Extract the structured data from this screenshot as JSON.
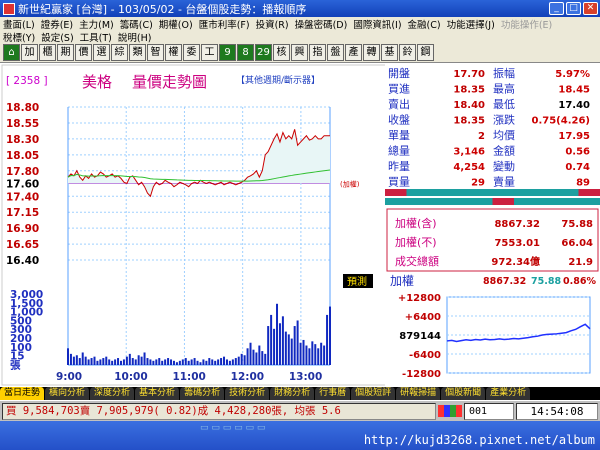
{
  "window": {
    "title": "新世紀贏家 [台灣] - 103/05/02 - 台盤個股走勢：播報順序"
  },
  "menu": {
    "row1": [
      "畫面(L)",
      "證券(E)",
      "主力(M)",
      "籌碼(C)",
      "期權(O)",
      "匯市利率(F)",
      "投資(R)",
      "操盤密碼(D)",
      "國際資訊(I)",
      "金融(C)",
      "功能選擇(J)"
    ],
    "row1_disabled": "功能操作(E)",
    "row2": [
      "稅標(Y)",
      "設定(S)",
      "工具(T)",
      "說明(H)"
    ]
  },
  "toolbar": {
    "buttons": [
      "加",
      "櫃",
      "期",
      "價",
      "選",
      "綜",
      "類",
      "智",
      "權",
      "委",
      "工",
      "9",
      "8",
      "29",
      "核",
      "興",
      "指",
      "盤",
      "產",
      "轉",
      "基",
      "鈴",
      "鋼"
    ]
  },
  "stock": {
    "code": "[ 2358 ]",
    "name": "美格",
    "chart_title": "量價走勢圖",
    "other_cycle": "【其他週期/斷示器】"
  },
  "price_axis": [
    "18.80",
    "18.55",
    "18.30",
    "18.05",
    "17.80",
    "17.60",
    "17.40",
    "17.15",
    "16.90",
    "16.65",
    "16.40"
  ],
  "ref_price_label": "(加權)",
  "volume_axis": [
    "3,000",
    "1,500",
    "1,000",
    "500",
    "300",
    "200",
    "100",
    "15",
    "張"
  ],
  "time_axis": [
    "9:00",
    "10:00",
    "11:00",
    "12:00",
    "13:00"
  ],
  "forecast_button": "預測",
  "quote": [
    {
      "l1": "開盤",
      "v1": "17.70",
      "l2": "振幅",
      "v2": "5.97%"
    },
    {
      "l1": "買進",
      "v1": "18.35",
      "l2": "最高",
      "v2": "18.45"
    },
    {
      "l1": "賣出",
      "v1": "18.40",
      "l2": "最低",
      "v2": "17.40"
    },
    {
      "l1": "收盤",
      "v1": "18.35",
      "l2": "漲跌",
      "v2": "0.75(4.26)"
    },
    {
      "l1": "單量",
      "v1": "2",
      "l2": "均價",
      "v2": "17.95"
    },
    {
      "l1": "總量",
      "v1": "3,146",
      "l2": "金額",
      "v2": "0.56"
    },
    {
      "l1": "昨量",
      "v1": "4,254",
      "l2": "變動",
      "v2": "0.74"
    },
    {
      "l1": "買量",
      "v1": "29",
      "l2": "賣量",
      "v2": "89"
    }
  ],
  "index": [
    {
      "label": "加權(含)",
      "value": "8867.32",
      "change": "75.88"
    },
    {
      "label": "加權(不)",
      "value": "7553.01",
      "change": "66.04"
    },
    {
      "label": "成交總額",
      "value": "972.34億",
      "change": "21.9"
    }
  ],
  "mini": {
    "label": "加權",
    "value": "8867.32",
    "change": "75.88",
    "pct": "0.86%",
    "axis": [
      "+12800",
      "+6400",
      "879144",
      "-6400",
      "-12800"
    ]
  },
  "tabs": [
    "當日走勢",
    "橫向分析",
    "深度分析",
    "基本分析",
    "籌碼分析",
    "技術分析",
    "財務分析",
    "行事曆",
    "個股短評",
    "研報掃描",
    "個股新聞",
    "產業分析"
  ],
  "status": {
    "ticker": "買 9,584,703賣 7,905,979( 0.82)成 4,428,280張, 均張 5.6",
    "page": "001",
    "time": "14:54:08"
  },
  "watermark": "http://kujd3268.pixnet.net/album",
  "colors": {
    "up": "#ff0000",
    "price_line": "#cc0000",
    "fill": "#e8f6f6",
    "avg_line": "#30c030",
    "volume": "#1028c0",
    "gridline": "#5aa0ff",
    "purple": "#9a22cc"
  },
  "chart_data": [
    {
      "type": "line",
      "title": "量價走勢圖",
      "x": [
        "9:00",
        "10:00",
        "11:00",
        "12:00",
        "13:00"
      ],
      "ylim": [
        16.4,
        18.8
      ],
      "series": [
        {
          "values": [
            17.7,
            17.75,
            17.72,
            17.8,
            17.7,
            17.65,
            17.72,
            17.68,
            17.75,
            17.7,
            17.72,
            17.78,
            17.75,
            17.7,
            17.72,
            17.75,
            17.7,
            17.72,
            17.68,
            17.62,
            17.6,
            17.7,
            17.72,
            17.65,
            17.58,
            17.62,
            17.55,
            17.45,
            17.4,
            17.55,
            17.62,
            17.58,
            17.6,
            17.65,
            17.62,
            17.6,
            17.55,
            17.58,
            17.62,
            17.6,
            17.58,
            17.55,
            17.6,
            17.62,
            17.6,
            17.65,
            17.62,
            17.6,
            17.62,
            17.6,
            17.58,
            17.6,
            17.62,
            17.58,
            17.6,
            17.62,
            17.6,
            17.58,
            17.6,
            17.62,
            17.65,
            17.7,
            17.72,
            17.75,
            17.8,
            17.7,
            17.8,
            18.05,
            18.1,
            18.2,
            18.3,
            18.38,
            18.25,
            18.4,
            18.3,
            18.35,
            18.3,
            18.45,
            18.2,
            18.25,
            18.3,
            18.35,
            18.28,
            18.3,
            18.35,
            18.3,
            18.3,
            18.35,
            18.35,
            18.35
          ]
        }
      ],
      "volume": [
        60,
        40,
        30,
        35,
        25,
        45,
        30,
        20,
        25,
        30,
        15,
        20,
        25,
        30,
        20,
        15,
        20,
        25,
        15,
        20,
        30,
        40,
        25,
        20,
        35,
        30,
        45,
        25,
        20,
        15,
        20,
        25,
        15,
        20,
        25,
        20,
        15,
        10,
        15,
        20,
        25,
        15,
        20,
        25,
        15,
        10,
        20,
        15,
        25,
        20,
        15,
        20,
        25,
        30,
        20,
        15,
        20,
        25,
        30,
        40,
        35,
        60,
        80,
        55,
        45,
        70,
        50,
        40,
        140,
        180,
        130,
        220,
        150,
        175,
        120,
        110,
        95,
        140,
        160,
        80,
        90,
        70,
        60,
        85,
        75,
        60,
        80,
        70,
        180,
        210
      ]
    },
    {
      "type": "line",
      "title": "加權",
      "ylim": [
        -12800,
        12800
      ],
      "series": [
        {
          "name": "加權",
          "values": [
            -2000,
            -1800,
            -2200,
            -1900,
            -1600,
            -1800,
            -1500,
            -1700,
            -1400,
            -1600,
            -1500,
            -1300,
            -1500,
            -1400,
            -1200,
            -1300,
            -1100,
            -900,
            -600,
            -400,
            0,
            200,
            300,
            400,
            600,
            800,
            1400,
            1900,
            2800,
            3600,
            2100
          ]
        }
      ]
    }
  ]
}
